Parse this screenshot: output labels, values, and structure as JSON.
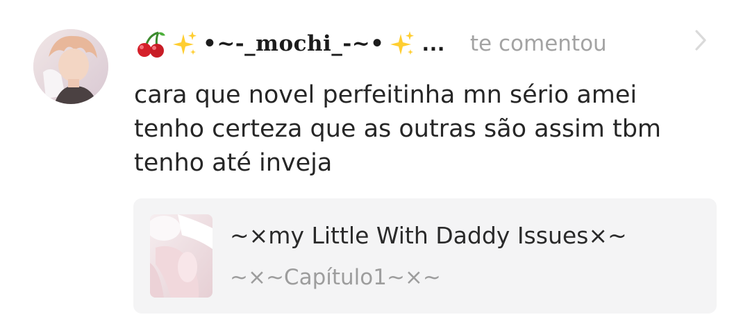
{
  "notification": {
    "username": "•~-_mochi_-~•",
    "username_truncation": "...",
    "username_emojis": [
      "cherry-icon",
      "sparkles-icon",
      "sparkles-icon"
    ],
    "action_text": "te comentou",
    "comment_lines": [
      "cara que novel perfeitinha mn sério amei",
      "tenho certeza que as outras são assim tbm",
      "tenho até inveja"
    ],
    "story_card": {
      "title": "~×my Little With Daddy Issues×~",
      "chapter": "~×~Capítulo1~×~"
    }
  },
  "colors": {
    "text_primary": "#262626",
    "text_muted": "#a3a3a3",
    "card_background": "#f4f4f5",
    "chevron": "#dadada"
  }
}
